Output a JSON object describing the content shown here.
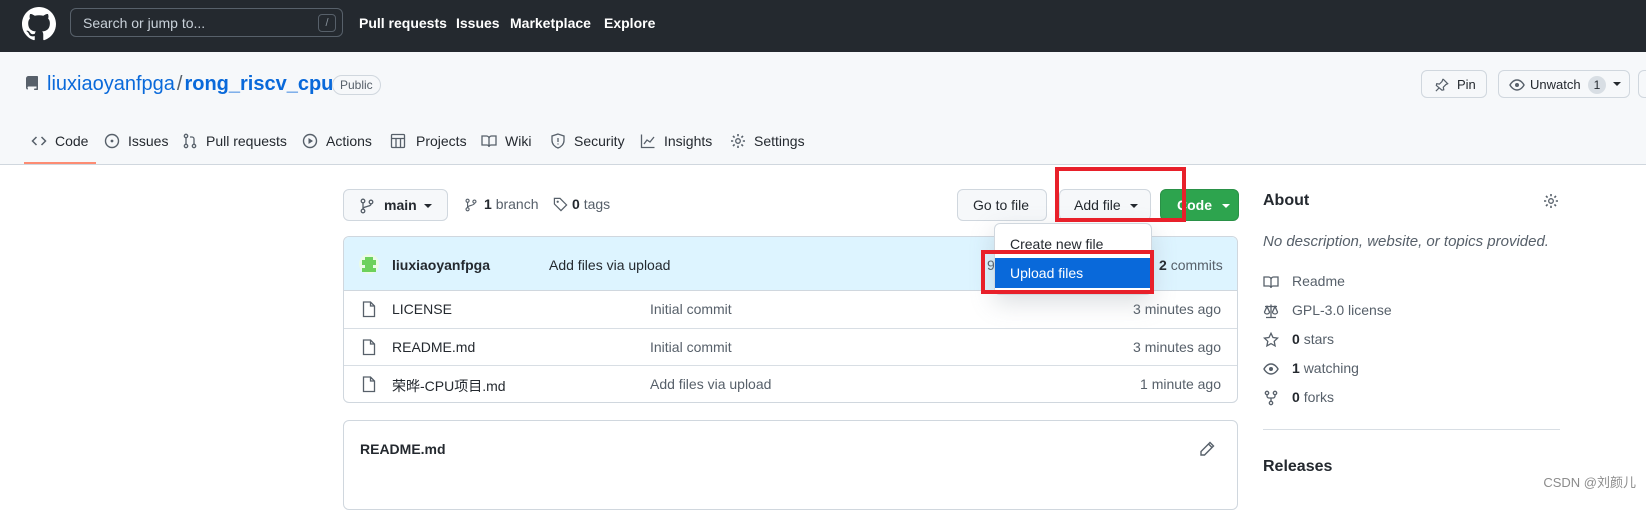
{
  "header": {
    "search_placeholder": "Search or jump to...",
    "search_key": "/",
    "nav": [
      "Pull requests",
      "Issues",
      "Marketplace",
      "Explore"
    ]
  },
  "repo": {
    "owner": "liuxiaoyanfpga",
    "separator": "/",
    "name": "rong_riscv_cpu",
    "visibility": "Public",
    "pin_label": "Pin",
    "unwatch_label": "Unwatch",
    "watch_count": "1"
  },
  "tabs": [
    {
      "label": "Code",
      "icon": "code-icon"
    },
    {
      "label": "Issues",
      "icon": "issue-icon"
    },
    {
      "label": "Pull requests",
      "icon": "pull-request-icon"
    },
    {
      "label": "Actions",
      "icon": "play-icon"
    },
    {
      "label": "Projects",
      "icon": "table-icon"
    },
    {
      "label": "Wiki",
      "icon": "book-icon"
    },
    {
      "label": "Security",
      "icon": "shield-icon"
    },
    {
      "label": "Insights",
      "icon": "graph-icon"
    },
    {
      "label": "Settings",
      "icon": "gear-icon"
    }
  ],
  "toolbar": {
    "branch": "main",
    "branch_count": "1",
    "branch_word": "branch",
    "tag_count": "0",
    "tag_word": "tags",
    "goto_file": "Go to file",
    "add_file": "Add file",
    "code": "Code"
  },
  "dropdown": {
    "create_new_file": "Create new file",
    "upload_files": "Upload files"
  },
  "commit": {
    "author": "liuxiaoyanfpga",
    "message": "Add files via upload",
    "hash_partial": "9",
    "commits_count": "2",
    "commits_word": "commits"
  },
  "files": [
    {
      "name": "LICENSE",
      "message": "Initial commit",
      "time": "3 minutes ago"
    },
    {
      "name": "README.md",
      "message": "Initial commit",
      "time": "3 minutes ago"
    },
    {
      "name": "荣晔-CPU项目.md",
      "message": "Add files via upload",
      "time": "1 minute ago"
    }
  ],
  "readme": {
    "title": "README.md"
  },
  "sidebar": {
    "about_title": "About",
    "description": "No description, website, or topics provided.",
    "readme": "Readme",
    "license": "GPL-3.0 license",
    "stars_count": "0",
    "stars_word": "stars",
    "watching_count": "1",
    "watching_word": "watching",
    "forks_count": "0",
    "forks_word": "forks",
    "releases_title": "Releases"
  },
  "watermark": "CSDN @刘颜儿",
  "colors": {
    "header_bg": "#24292f",
    "accent": "#0969da",
    "code_button": "#2da44e",
    "highlight_box": "#e8202a",
    "tab_underline": "#fd8c73"
  }
}
